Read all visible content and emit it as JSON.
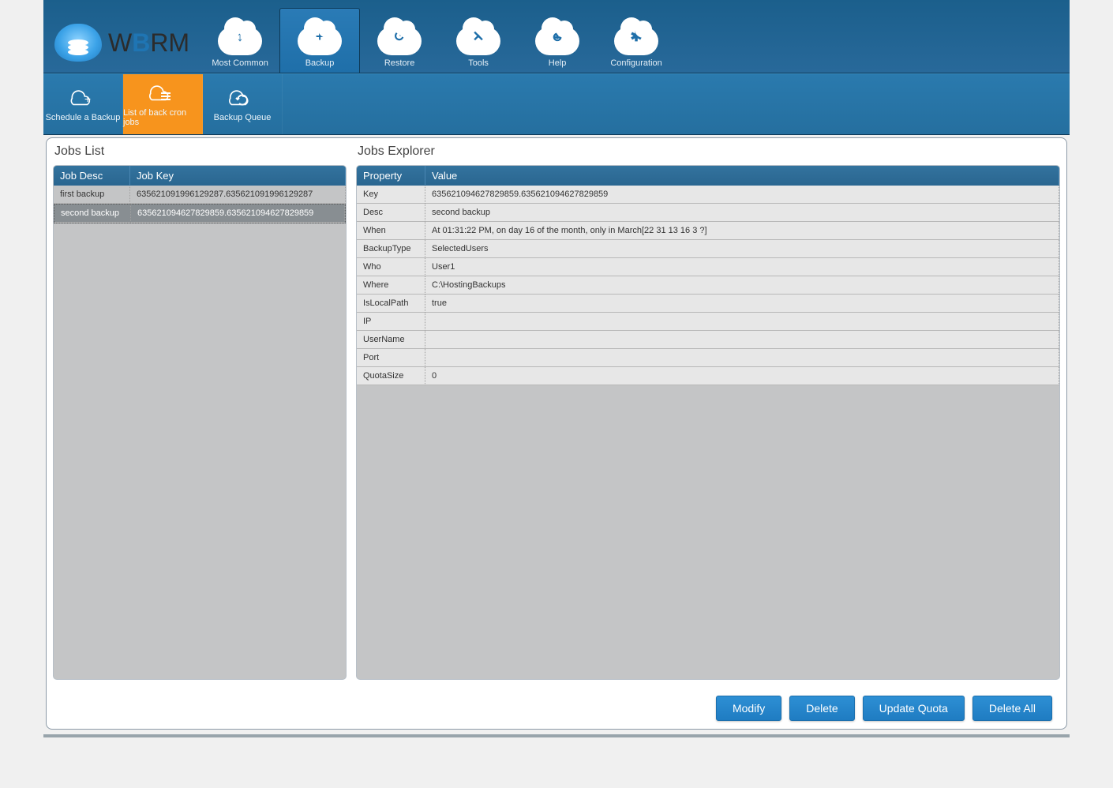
{
  "brand": {
    "name": "WBRM"
  },
  "topnav": [
    {
      "label": "Most Common",
      "icon": "↕"
    },
    {
      "label": "Backup",
      "icon": "+",
      "active": true
    },
    {
      "label": "Restore",
      "icon": "↺"
    },
    {
      "label": "Tools",
      "icon": "✕"
    },
    {
      "label": "Help",
      "icon": "☻"
    },
    {
      "label": "Configuration",
      "icon": "✱"
    }
  ],
  "subnav": [
    {
      "label": "Schedule a Backup"
    },
    {
      "label": "List of back cron jobs",
      "active": true
    },
    {
      "label": "Backup Queue"
    }
  ],
  "jobs_list": {
    "title": "Jobs List",
    "headers": [
      "Job Desc",
      "Job Key"
    ],
    "rows": [
      {
        "desc": "first backup",
        "key": "635621091996129287.635621091996129287",
        "selected": false
      },
      {
        "desc": "second backup",
        "key": "635621094627829859.635621094627829859",
        "selected": true
      }
    ]
  },
  "jobs_explorer": {
    "title": "Jobs Explorer",
    "headers": [
      "Property",
      "Value"
    ],
    "rows": [
      {
        "p": "Key",
        "v": "635621094627829859.635621094627829859"
      },
      {
        "p": "Desc",
        "v": "second backup"
      },
      {
        "p": "When",
        "v": "At 01:31:22 PM, on day 16 of the month, only in March[22 31 13 16 3 ?]"
      },
      {
        "p": "BackupType",
        "v": "SelectedUsers"
      },
      {
        "p": "Who",
        "v": "User1"
      },
      {
        "p": "Where",
        "v": "C:\\HostingBackups"
      },
      {
        "p": "IsLocalPath",
        "v": "true"
      },
      {
        "p": "IP",
        "v": ""
      },
      {
        "p": "UserName",
        "v": ""
      },
      {
        "p": "Port",
        "v": ""
      },
      {
        "p": "QuotaSize",
        "v": "0"
      }
    ]
  },
  "buttons": {
    "modify": "Modify",
    "delete": "Delete",
    "update_quota": "Update Quota",
    "delete_all": "Delete All"
  }
}
